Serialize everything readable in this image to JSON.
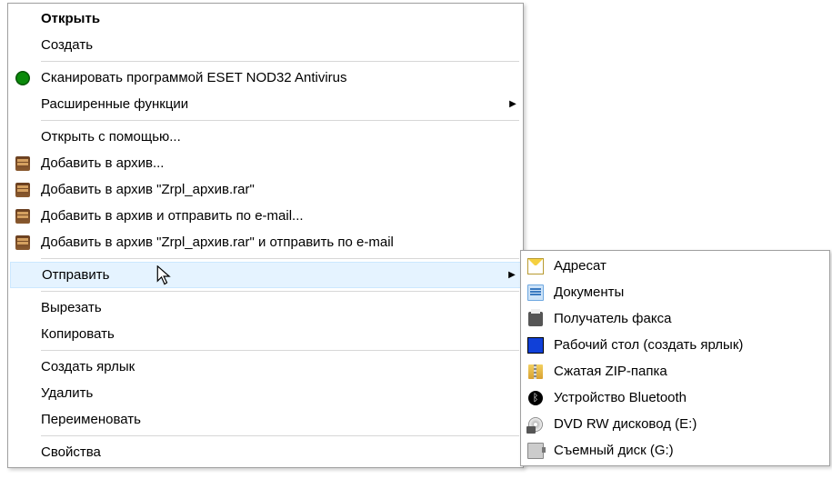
{
  "main": {
    "items": [
      {
        "label": "Открыть",
        "bold": true
      },
      {
        "label": "Создать"
      }
    ],
    "scan": [
      {
        "label": "Сканировать программой ESET NOD32 Antivirus",
        "icon": "eset"
      },
      {
        "label": "Расширенные функции",
        "arrow": true
      }
    ],
    "openwith": {
      "label": "Открыть с помощью..."
    },
    "rar": [
      {
        "label": "Добавить в архив...",
        "icon": "rar"
      },
      {
        "label": "Добавить в архив \"Zrpl_архив.rar\"",
        "icon": "rar"
      },
      {
        "label": "Добавить в архив и отправить по e-mail...",
        "icon": "rar"
      },
      {
        "label": "Добавить в архив \"Zrpl_архив.rar\" и отправить по e-mail",
        "icon": "rar"
      }
    ],
    "send": {
      "label": "Отправить"
    },
    "edit": [
      {
        "label": "Вырезать"
      },
      {
        "label": "Копировать"
      }
    ],
    "file": [
      {
        "label": "Создать ярлык"
      },
      {
        "label": "Удалить"
      },
      {
        "label": "Переименовать"
      }
    ],
    "props": {
      "label": "Свойства"
    }
  },
  "sub": {
    "items": [
      {
        "label": "Адресат",
        "icon": "mail"
      },
      {
        "label": "Документы",
        "icon": "docs"
      },
      {
        "label": "Получатель факса",
        "icon": "fax"
      },
      {
        "label": "Рабочий стол (создать ярлык)",
        "icon": "desktop"
      },
      {
        "label": "Сжатая ZIP-папка",
        "icon": "zip"
      },
      {
        "label": "Устройство Bluetooth",
        "icon": "bt"
      },
      {
        "label": "DVD RW дисковод (E:)",
        "icon": "dvd"
      },
      {
        "label": "Съемный диск (G:)",
        "icon": "usb"
      }
    ]
  }
}
